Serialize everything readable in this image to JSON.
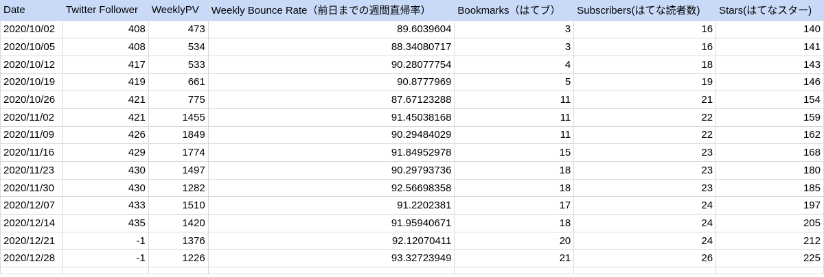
{
  "columns": [
    "Date",
    "Twitter Follower",
    "WeeklyPV",
    "Weekly Bounce Rate（前日までの週間直帰率）",
    "Bookmarks（はてブ）",
    "Subscribers(はてな読者数)",
    "Stars(はてなスター)"
  ],
  "rows": [
    [
      "2020/10/02",
      "408",
      "473",
      "89.6039604",
      "3",
      "16",
      "140"
    ],
    [
      "2020/10/05",
      "408",
      "534",
      "88.34080717",
      "3",
      "16",
      "141"
    ],
    [
      "2020/10/12",
      "417",
      "533",
      "90.28077754",
      "4",
      "18",
      "143"
    ],
    [
      "2020/10/19",
      "419",
      "661",
      "90.8777969",
      "5",
      "19",
      "146"
    ],
    [
      "2020/10/26",
      "421",
      "775",
      "87.67123288",
      "11",
      "21",
      "154"
    ],
    [
      "2020/11/02",
      "421",
      "1455",
      "91.45038168",
      "11",
      "22",
      "159"
    ],
    [
      "2020/11/09",
      "426",
      "1849",
      "90.29484029",
      "11",
      "22",
      "162"
    ],
    [
      "2020/11/16",
      "429",
      "1774",
      "91.84952978",
      "15",
      "23",
      "168"
    ],
    [
      "2020/11/23",
      "430",
      "1497",
      "90.29793736",
      "18",
      "23",
      "180"
    ],
    [
      "2020/11/30",
      "430",
      "1282",
      "92.56698358",
      "18",
      "23",
      "185"
    ],
    [
      "2020/12/07",
      "433",
      "1510",
      "91.2202381",
      "17",
      "24",
      "197"
    ],
    [
      "2020/12/14",
      "435",
      "1420",
      "91.95940671",
      "18",
      "24",
      "205"
    ],
    [
      "2020/12/21",
      "-1",
      "1376",
      "92.12070411",
      "20",
      "24",
      "212"
    ],
    [
      "2020/12/28",
      "-1",
      "1226",
      "93.32723949",
      "21",
      "26",
      "225"
    ]
  ],
  "colors": {
    "header_background": "#c9daf8",
    "gridline": "#d9d9d9"
  }
}
